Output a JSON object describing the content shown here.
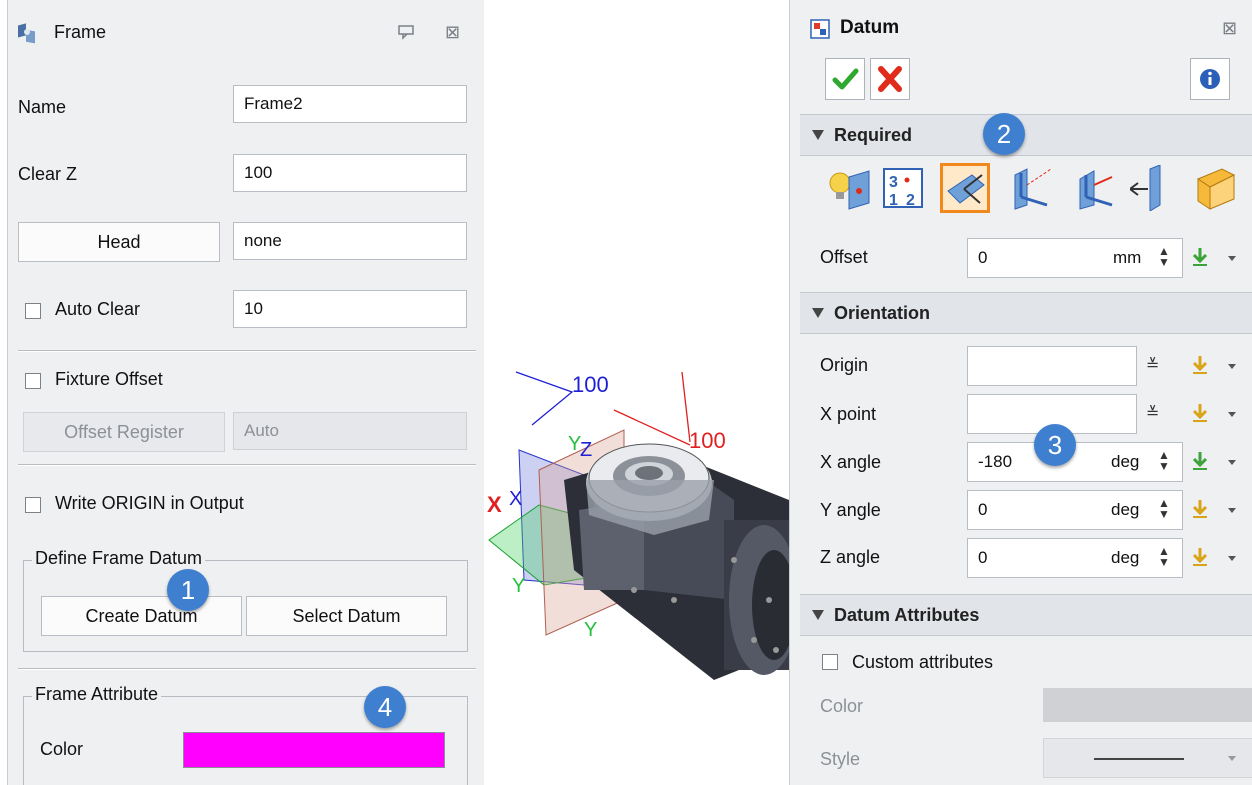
{
  "frame_panel": {
    "title": "Frame",
    "name_label": "Name",
    "name_value": "Frame2",
    "clear_z_label": "Clear Z",
    "clear_z_value": "100",
    "head_button": "Head",
    "head_value": "none",
    "auto_clear_label": "Auto Clear",
    "auto_clear_value": "10",
    "fixture_offset_label": "Fixture Offset",
    "offset_register_button": "Offset Register",
    "offset_register_value": "Auto",
    "write_origin_label": "Write ORIGIN in Output",
    "define_datum_legend": "Define Frame Datum",
    "create_datum_button": "Create Datum",
    "select_datum_button": "Select Datum",
    "frame_attribute_legend": "Frame Attribute",
    "color_label": "Color",
    "color_value": "#ff00ff"
  },
  "badges": [
    "1",
    "2",
    "3",
    "4"
  ],
  "viewport": {
    "axis_label_100_blue": "100",
    "axis_label_100_red": "100",
    "axis_x": "X",
    "axis_x_blue": "X",
    "axis_y_left": "Y",
    "axis_y_bottom": "Y",
    "axis_y_top": "Y",
    "axis_z": "Z"
  },
  "datum_panel": {
    "title": "Datum",
    "ok_icon": "check-icon",
    "cancel_icon": "x-icon",
    "info_icon": "info-icon",
    "required_label": "Required",
    "offset_label": "Offset",
    "offset_value": "0",
    "offset_unit": "mm",
    "orientation_label": "Orientation",
    "origin_label": "Origin",
    "origin_value": "",
    "x_point_label": "X point",
    "x_point_value": "",
    "x_angle_label": "X angle",
    "x_angle_value": "-180",
    "y_angle_label": "Y angle",
    "y_angle_value": "0",
    "z_angle_label": "Z angle",
    "z_angle_value": "0",
    "angle_unit": "deg",
    "datum_attributes_label": "Datum Attributes",
    "custom_attributes_label": "Custom attributes",
    "color_label": "Color",
    "style_label": "Style"
  },
  "colors": {
    "badge": "#3f7fcf",
    "selected_method": "#f0881d",
    "frame_color": "#ff00ff"
  }
}
